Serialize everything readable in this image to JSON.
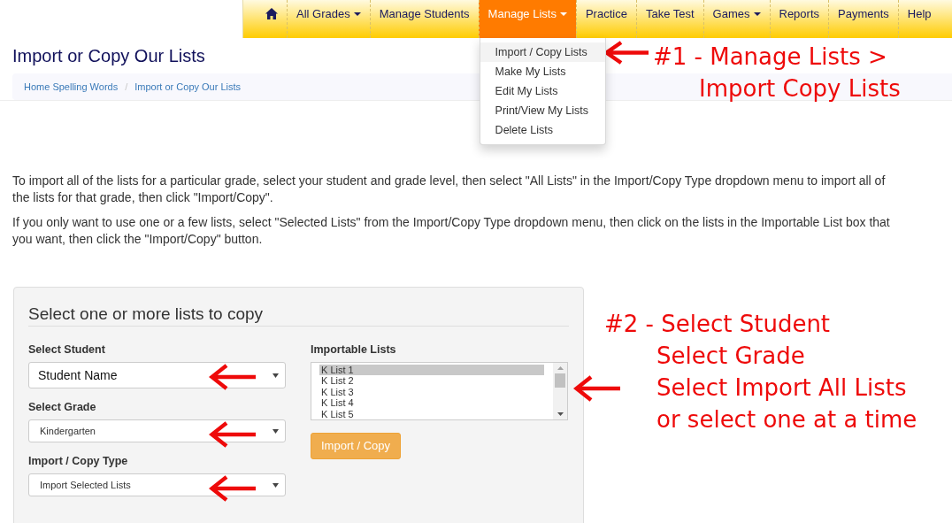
{
  "navbar": {
    "items": [
      {
        "kind": "home",
        "selected": false
      },
      {
        "kind": "link",
        "label": "All Grades",
        "dropdown": true,
        "selected": false
      },
      {
        "kind": "link",
        "label": "Manage Students",
        "dropdown": false,
        "selected": false
      },
      {
        "kind": "link",
        "label": "Manage Lists",
        "dropdown": true,
        "selected": true,
        "menu": [
          {
            "label": "Import / Copy Lists",
            "selected": true
          },
          {
            "label": "Make My Lists",
            "selected": false
          },
          {
            "label": "Edit My Lists",
            "selected": false
          },
          {
            "label": "Print/View My Lists",
            "selected": false
          },
          {
            "label": "Delete Lists",
            "selected": false
          }
        ]
      },
      {
        "kind": "link",
        "label": "Practice",
        "dropdown": false,
        "selected": false
      },
      {
        "kind": "link",
        "label": "Take Test",
        "dropdown": false,
        "selected": false
      },
      {
        "kind": "link",
        "label": "Games",
        "dropdown": true,
        "selected": false
      },
      {
        "kind": "link",
        "label": "Reports",
        "dropdown": false,
        "selected": false
      },
      {
        "kind": "link",
        "label": "Payments",
        "dropdown": false,
        "selected": false
      },
      {
        "kind": "link",
        "label": "Help",
        "dropdown": false,
        "selected": false
      }
    ]
  },
  "page_title": "Import or Copy Our Lists",
  "breadcrumb": {
    "items": [
      "Home Spelling Words",
      "Import or Copy Our Lists"
    ],
    "separator": "/"
  },
  "instructions": [
    "To import all of the lists for a particular grade, select your student and grade level, then select \"All Lists\" in the Import/Copy Type dropdown menu to import all of the lists for that grade, then click \"Import/Copy\".",
    "If you only want to use one or a few lists, select \"Selected Lists\" from the Import/Copy Type dropdown menu, then click on the lists in the Importable List box that you want, then click the \"Import/Copy\" button."
  ],
  "panel": {
    "title": "Select one or more lists to copy",
    "fields": [
      {
        "label": "Select Student",
        "value": "Student Name"
      },
      {
        "label": "Select Grade",
        "value": "Kindergarten"
      },
      {
        "label": "Import / Copy Type",
        "value": "Import Selected Lists"
      }
    ],
    "list": {
      "label": "Importable Lists",
      "options": [
        {
          "label": "K List 1",
          "selected": true
        },
        {
          "label": "K List 2",
          "selected": false
        },
        {
          "label": "K List 3",
          "selected": false
        },
        {
          "label": "K List 4",
          "selected": false
        },
        {
          "label": "K List 5",
          "selected": false
        }
      ]
    },
    "button": "Import / Copy"
  },
  "annotations": [
    {
      "lines": [
        "#1 - Manage Lists >",
        "Import Copy Lists"
      ]
    },
    {
      "lines": [
        "#2 - Select Student",
        "Select Grade",
        "Select Import All Lists",
        "or select one at a time"
      ]
    }
  ]
}
